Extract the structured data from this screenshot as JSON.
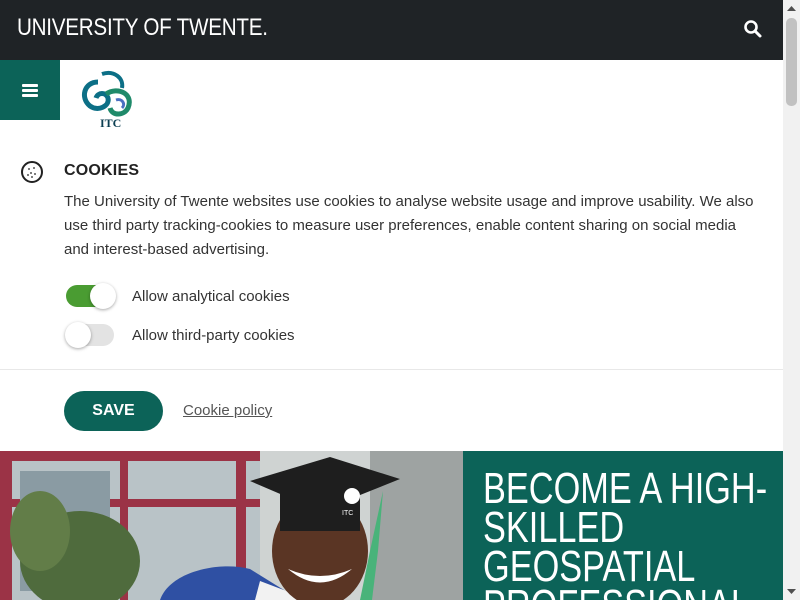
{
  "header": {
    "brand": "UNIVERSITY OF TWENTE.",
    "search_icon": "search-icon"
  },
  "subheader": {
    "menu_icon": "hamburger-menu-icon",
    "logo_text": "ITC"
  },
  "cookies": {
    "icon": "cookie-icon",
    "title": "COOKIES",
    "text": "The University of Twente websites use cookies to analyse website usage and improve usability. We also use third party tracking-cookies to measure user preferences, enable content sharing on social media and interest-based advertising.",
    "toggles": [
      {
        "label": "Allow analytical cookies",
        "enabled": true
      },
      {
        "label": "Allow third-party cookies",
        "enabled": false
      }
    ],
    "save_label": "SAVE",
    "policy_label": "Cookie policy"
  },
  "hero": {
    "title": "BECOME A HIGH-SKILLED GEOSPATIAL PROFESSIONAL",
    "cap_logo_text": "ITC"
  },
  "colors": {
    "brand_dark": "#1f2326",
    "accent_green": "#0c6358",
    "toggle_on": "#4a9c32",
    "toggle_off": "#e3e3e3"
  }
}
